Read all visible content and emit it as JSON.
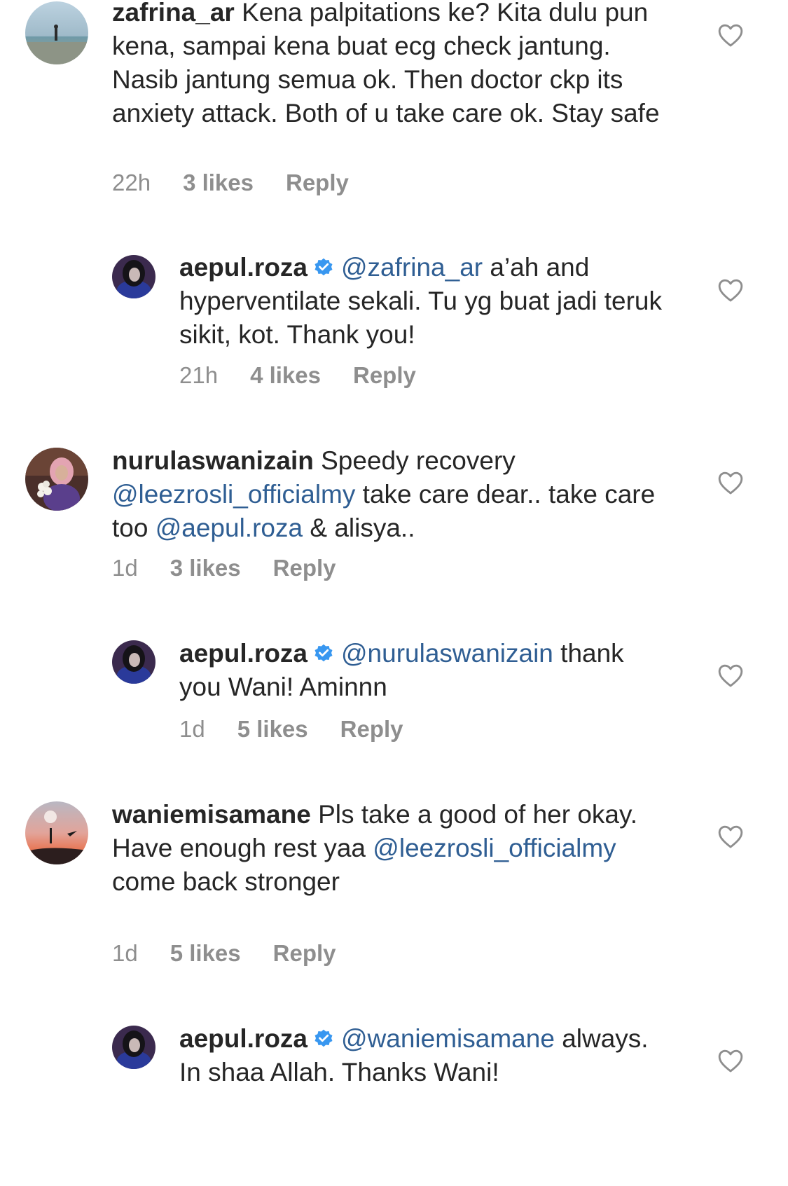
{
  "comments": [
    {
      "username": "zafrina_ar",
      "text": " Kena palpitations ke? Kita dulu pun kena, sampai kena buat ecg check jantung. Nasib jantung semua ok. Then doctor ckp its anxiety attack. Both of u take care ok. Stay safe",
      "time": "22h",
      "likes": "3 likes",
      "reply": "Reply"
    },
    {
      "username": "aepul.roza",
      "mention": "@zafrina_ar",
      "text": " a’ah and hyperventilate sekali. Tu yg buat jadi teruk sikit, kot. Thank you!",
      "time": "21h",
      "likes": "4 likes",
      "reply": "Reply"
    },
    {
      "username": "nurulaswanizain",
      "text1": " Speedy recovery ",
      "mention1": "@leezrosli_officialmy",
      "text2": " take care dear.. take care too  ",
      "mention2": "@aepul.roza",
      "text3": " & alisya..",
      "time": "1d",
      "likes": "3 likes",
      "reply": "Reply"
    },
    {
      "username": "aepul.roza",
      "mention": "@nurulaswanizain",
      "text": " thank you Wani! Aminnn",
      "time": "1d",
      "likes": "5 likes",
      "reply": "Reply"
    },
    {
      "username": "waniemisamane",
      "text1": " Pls take a good of her okay. Have enough rest yaa ",
      "mention1": "@leezrosli_officialmy",
      "text2": " come back stronger",
      "time": "1d",
      "likes": "5 likes",
      "reply": "Reply"
    },
    {
      "username": "aepul.roza",
      "mention": "@waniemisamane",
      "text": " always. In shaa Allah. Thanks Wani!"
    }
  ],
  "icons": {
    "like": "heart-outline-icon",
    "verified": "verified-badge-icon"
  },
  "colors": {
    "mention": "#2f5e93",
    "verified": "#3897f0",
    "meta": "#8e8e8e"
  }
}
